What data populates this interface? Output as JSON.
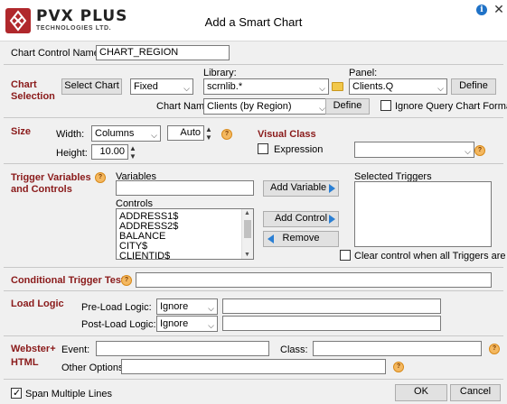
{
  "window": {
    "title": "Add a Smart Chart",
    "logo_main": "PVX PLUS",
    "logo_sub": "TECHNOLOGIES LTD.",
    "info_glyph": "i",
    "close_glyph": "✕"
  },
  "chart_control": {
    "label": "Chart Control Name:",
    "value": "CHART_REGION"
  },
  "chart_selection": {
    "section_label": "Chart Selection",
    "select_button": "Select Chart",
    "mode_value": "Fixed",
    "library_label": "Library:",
    "library_value": "scrnlib.*",
    "panel_label": "Panel:",
    "panel_value": "Clients.Q",
    "define_panel_button": "Define",
    "chart_name_label": "Chart Name:",
    "chart_name_value": "Clients (by Region)",
    "define_chart_button": "Define",
    "ignore_query_label": "Ignore Query Chart Format",
    "ignore_query_checked": false
  },
  "size": {
    "section_label": "Size",
    "width_label": "Width:",
    "width_unit": "Columns",
    "width_value": "Auto",
    "height_label": "Height:",
    "height_value": "10.00"
  },
  "visual_class": {
    "section_label": "Visual Class",
    "expression_label": "Expression",
    "expression_checked": false,
    "class_value": ""
  },
  "triggers": {
    "section_label": "Trigger Variables and Controls",
    "variables_label": "Variables",
    "variables_value": "",
    "add_variable_button": "Add Variable",
    "controls_label": "Controls",
    "controls": [
      "ADDRESS1$",
      "ADDRESS2$",
      "BALANCE",
      "CITY$",
      "CLIENTID$"
    ],
    "add_control_button": "Add Control",
    "remove_button": "Remove",
    "selected_label": "Selected Triggers",
    "clear_label": "Clear control when all Triggers are null",
    "clear_checked": false
  },
  "conditional": {
    "section_label": "Conditional Trigger Test",
    "value": ""
  },
  "load_logic": {
    "section_label": "Load Logic",
    "pre_label": "Pre-Load Logic:",
    "pre_mode": "Ignore",
    "pre_value": "",
    "post_label": "Post-Load Logic:",
    "post_mode": "Ignore",
    "post_value": ""
  },
  "webster": {
    "section_label1": "Webster+",
    "section_label2": "HTML",
    "event_label": "Event:",
    "event_value": "",
    "class_label": "Class:",
    "class_value": "",
    "other_label": "Other Options:",
    "other_value": ""
  },
  "footer": {
    "span_label": "Span Multiple Lines",
    "span_checked": true,
    "ok_button": "OK",
    "cancel_button": "Cancel"
  },
  "colors": {
    "section": "#8a1a1a",
    "brand": "#b0282c",
    "arrow": "#2a7fd4"
  }
}
